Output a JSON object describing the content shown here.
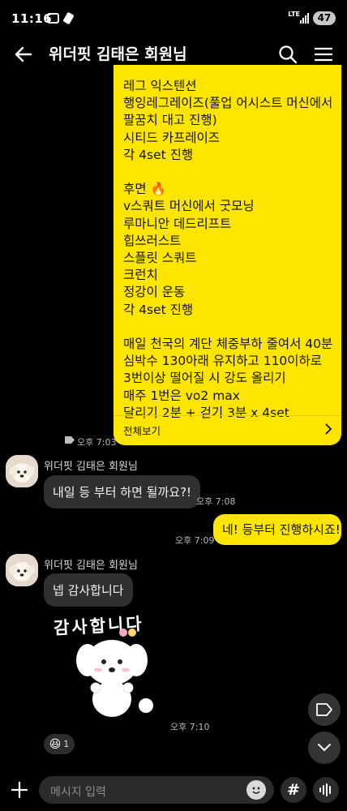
{
  "status_bar": {
    "time": "11:16",
    "network": "LTE",
    "battery": "47"
  },
  "header": {
    "title": "위더핏 김태은 회원님",
    "back_icon": "arrow-left-icon",
    "search_icon": "search-icon",
    "menu_icon": "hamburger-menu-icon"
  },
  "messages": {
    "long_message": {
      "text": "레그 익스텐션\n행잉레그레이즈(풀업 어시스트 머신에서\n팔꿈치 대고 진행)\n시티드 카프레이즈\n각 4set 진행\n\n후면 🔥\nv스쿼트 머신에서 굿모닝\n루마니안 데드리프트\n힙쓰러스트\n스플릿 스쿼트\n크런치\n정강이 운동\n각 4set 진행\n\n매일 천국의 계단 체중부하 줄여서 40분\n심박수 130아래 유지하고 110이하로\n3번이상 떨어질 시 강도 올리기\n매주 1번은 vo2 max\n달리기 2분 + 걷기 3분 x 4set",
      "view_all": "전체보기",
      "time": "오후 7:03"
    },
    "msg1": {
      "sender": "위더핏 김태은 회원님",
      "text": "내일 등 부터 하면 될까요?!",
      "time": "오후 7:08"
    },
    "msg2": {
      "text": "네! 등부터 진행하시죠!",
      "time": "오후 7:09"
    },
    "msg3": {
      "sender": "위더핏 김태은 회원님",
      "text": "넵 감사합니다",
      "sticker_text": "감사합니다",
      "time": "오후 7:10",
      "reaction_emoji": "😆",
      "reaction_count": "1"
    }
  },
  "input": {
    "placeholder": "메시지 입력",
    "hash": "#"
  },
  "colors": {
    "background": "#000000",
    "my_bubble": "#fee500",
    "other_bubble": "#303030"
  }
}
